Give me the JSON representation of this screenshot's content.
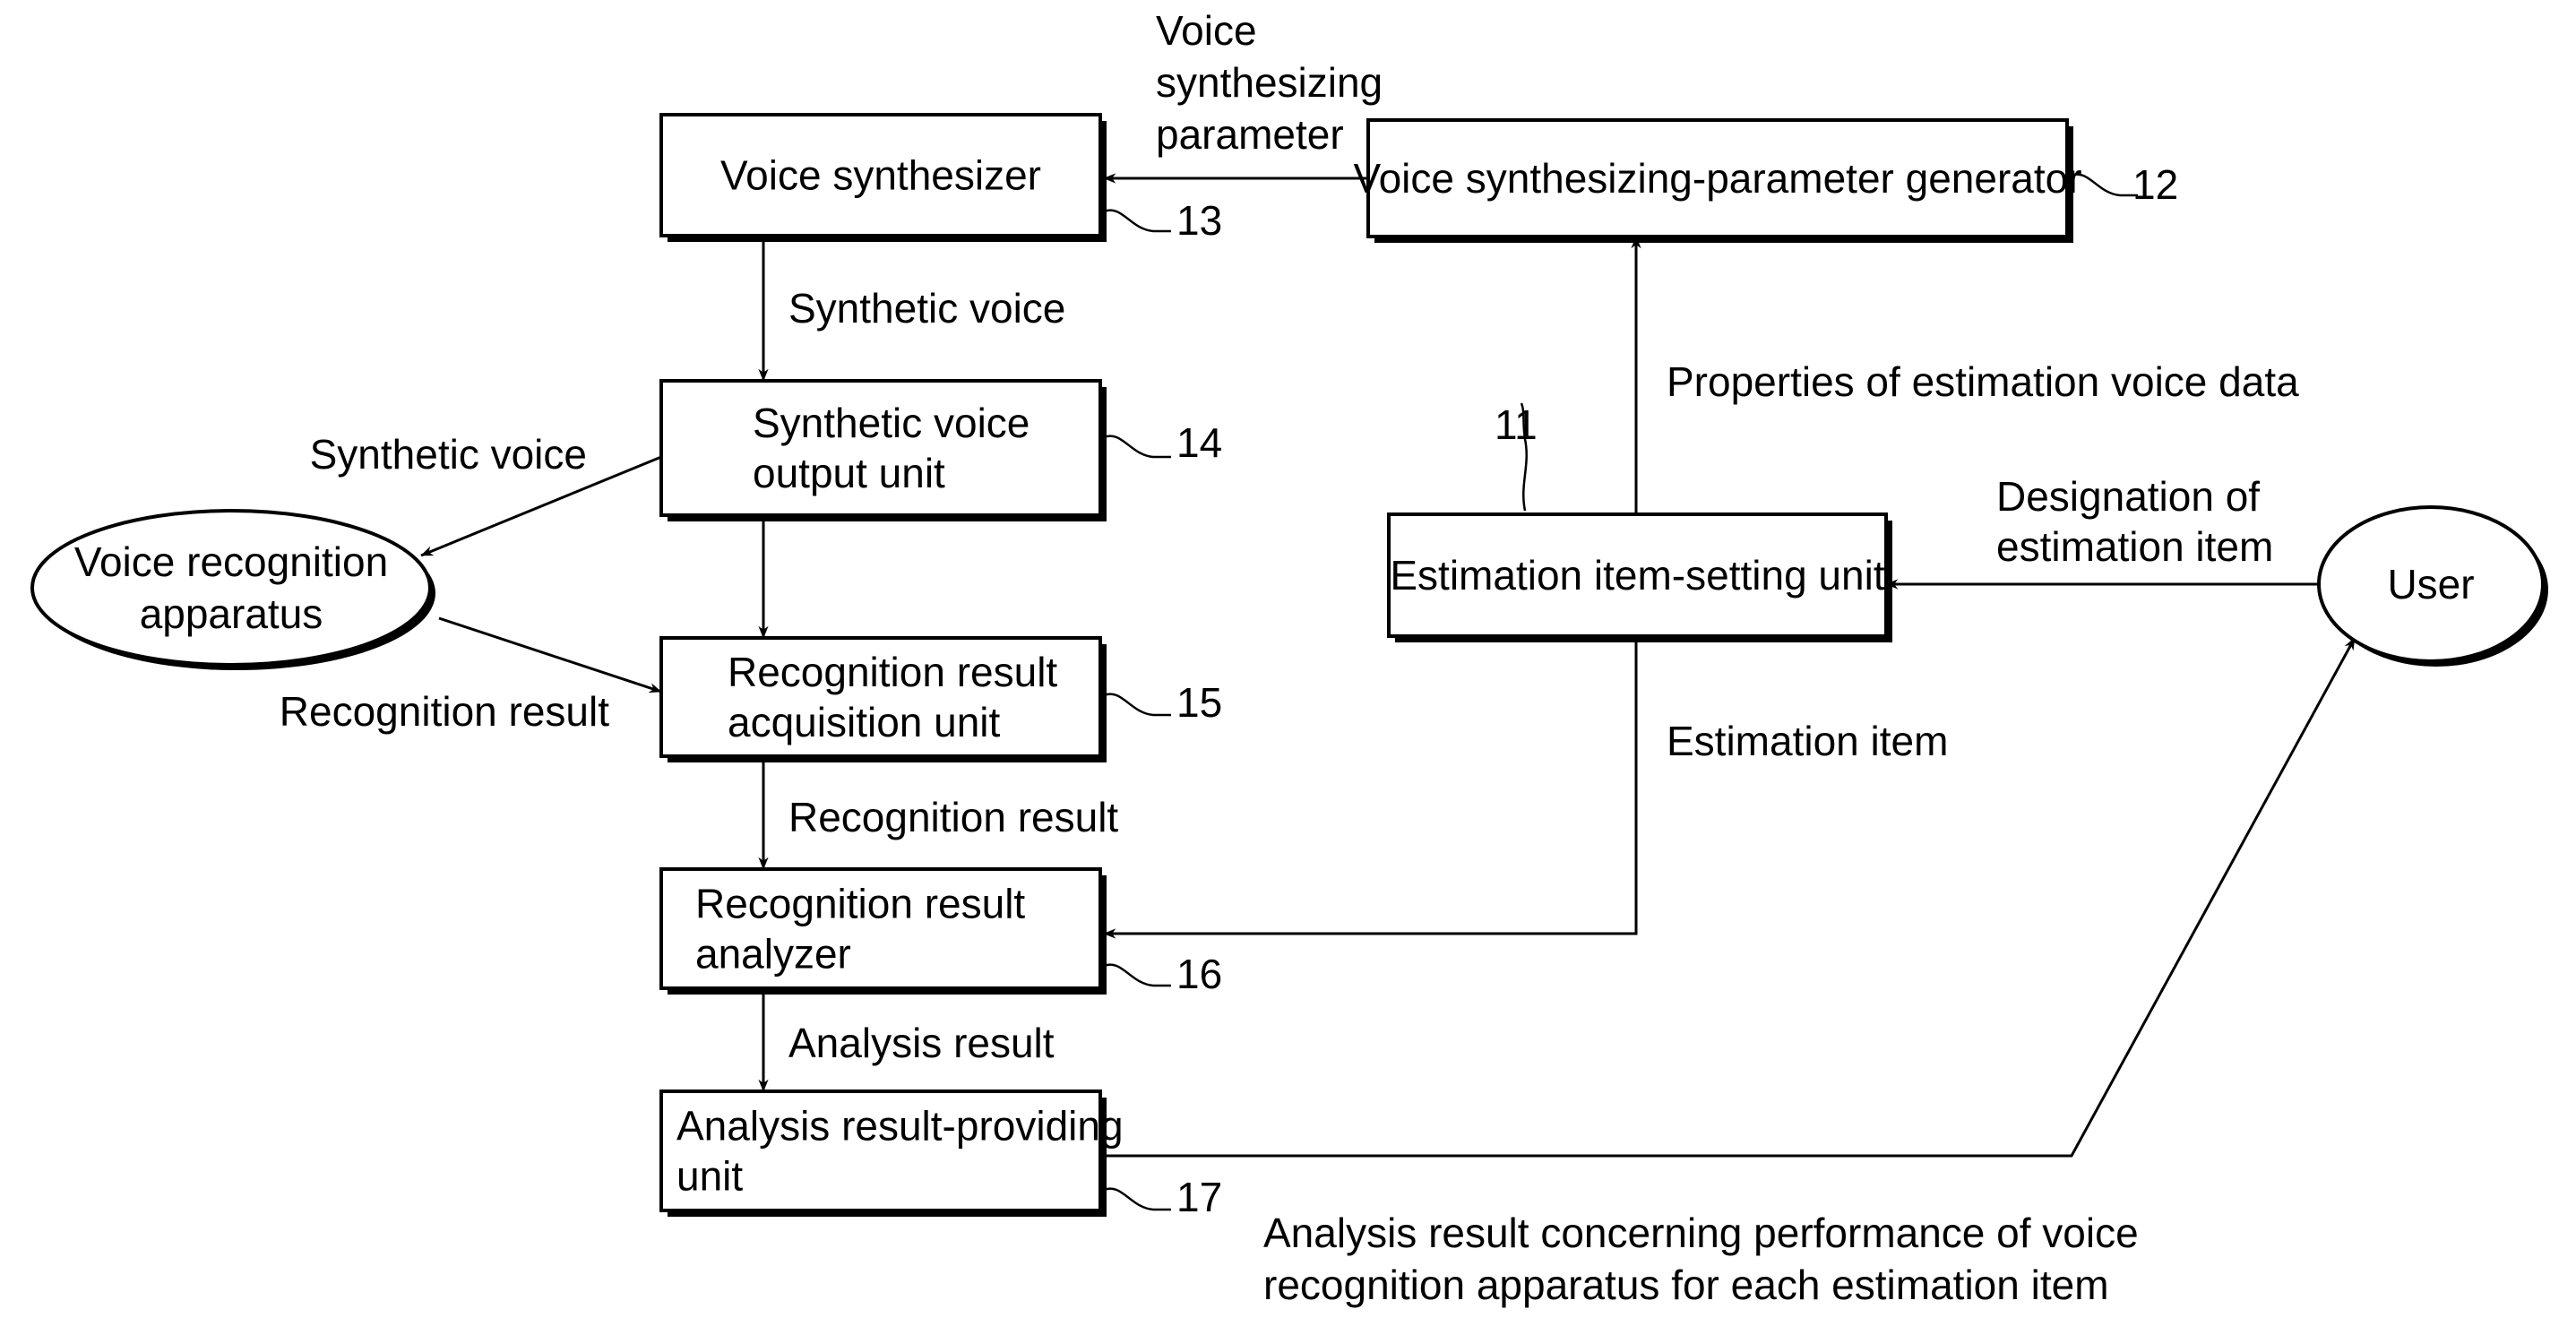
{
  "diagram": {
    "nodes": [
      {
        "id": "n11",
        "ref": "11",
        "lines": [
          "Estimation item-setting unit"
        ],
        "shape": "box"
      },
      {
        "id": "n12",
        "ref": "12",
        "lines": [
          "Voice synthesizing-parameter generator"
        ],
        "shape": "box"
      },
      {
        "id": "n13",
        "ref": "13",
        "lines": [
          "Voice synthesizer"
        ],
        "shape": "box"
      },
      {
        "id": "n14",
        "ref": "14",
        "lines": [
          "Synthetic voice",
          "output unit"
        ],
        "shape": "box"
      },
      {
        "id": "n15",
        "ref": "15",
        "lines": [
          "Recognition result",
          "acquisition unit"
        ],
        "shape": "box"
      },
      {
        "id": "n16",
        "ref": "16",
        "lines": [
          "Recognition result",
          "analyzer"
        ],
        "shape": "box"
      },
      {
        "id": "n17",
        "ref": "17",
        "lines": [
          "Analysis result-providing",
          "unit"
        ],
        "shape": "box"
      },
      {
        "id": "vra",
        "lines": [
          "Voice recognition",
          "apparatus"
        ],
        "shape": "ellipse"
      },
      {
        "id": "user",
        "lines": [
          "User"
        ],
        "shape": "ellipse"
      }
    ],
    "edges": [
      {
        "from": "n12",
        "to": "n13",
        "label": [
          "Voice",
          "synthesizing",
          "parameter"
        ]
      },
      {
        "from": "n13",
        "to": "n14",
        "label": [
          "Synthetic voice"
        ]
      },
      {
        "from": "n14",
        "to": "vra",
        "label": [
          "Synthetic voice"
        ]
      },
      {
        "from": "n14",
        "to": "n15",
        "label": []
      },
      {
        "from": "vra",
        "to": "n15",
        "label": [
          "Recognition result"
        ]
      },
      {
        "from": "n15",
        "to": "n16",
        "label": [
          "Recognition result"
        ]
      },
      {
        "from": "n16",
        "to": "n17",
        "label": [
          "Analysis result"
        ]
      },
      {
        "from": "n11",
        "to": "n12",
        "label": [
          "Properties of estimation voice data"
        ]
      },
      {
        "from": "user",
        "to": "n11",
        "label": [
          "Designation of",
          "estimation item"
        ]
      },
      {
        "from": "n11",
        "to": "n16",
        "label": [
          "Estimation item"
        ]
      },
      {
        "from": "n17",
        "to": "user",
        "label": [
          "Analysis result concerning performance of voice",
          "recognition apparatus for each estimation item"
        ]
      }
    ]
  }
}
